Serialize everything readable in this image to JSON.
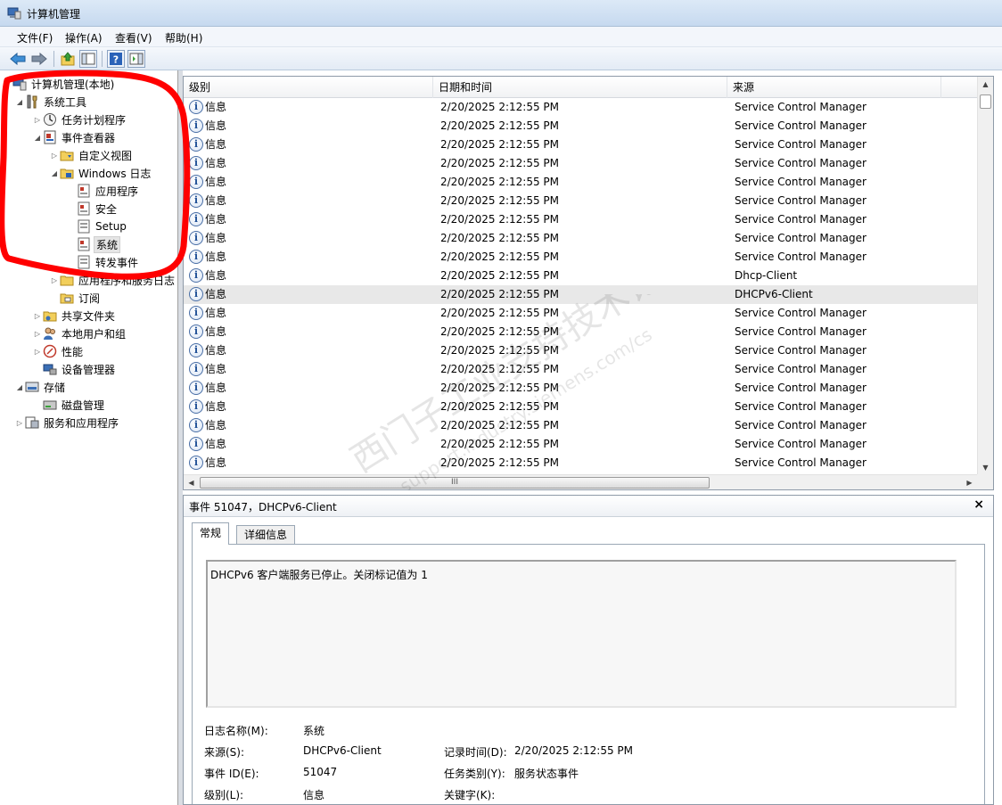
{
  "window": {
    "title": "计算机管理"
  },
  "menu": [
    "文件(F)",
    "操作(A)",
    "查看(V)",
    "帮助(H)"
  ],
  "toolbar": {
    "buttons": [
      "back-icon",
      "forward-icon",
      "up-folder-icon",
      "show-tree-icon",
      "help-icon",
      "action-pane-icon"
    ]
  },
  "tree": [
    {
      "label": "计算机管理(本地)",
      "icon": "computer-management-icon",
      "expander": ""
    },
    {
      "label": "系统工具",
      "icon": "system-tools-icon",
      "expander": "◢"
    },
    {
      "label": "任务计划程序",
      "icon": "task-scheduler-icon",
      "expander": "▷"
    },
    {
      "label": "事件查看器",
      "icon": "event-viewer-icon",
      "expander": "◢"
    },
    {
      "label": "自定义视图",
      "icon": "custom-views-folder-icon",
      "expander": "▷"
    },
    {
      "label": "Windows 日志",
      "icon": "windows-logs-folder-icon",
      "expander": "◢"
    },
    {
      "label": "应用程序",
      "icon": "log-icon",
      "expander": ""
    },
    {
      "label": "安全",
      "icon": "log-icon",
      "expander": ""
    },
    {
      "label": "Setup",
      "icon": "log-icon",
      "expander": ""
    },
    {
      "label": "系统",
      "icon": "log-icon",
      "expander": ""
    },
    {
      "label": "转发事件",
      "icon": "log-icon",
      "expander": ""
    },
    {
      "label": "应用程序和服务日志",
      "icon": "folder-icon",
      "expander": "▷"
    },
    {
      "label": "订阅",
      "icon": "subscriptions-icon",
      "expander": ""
    },
    {
      "label": "共享文件夹",
      "icon": "shared-folders-icon",
      "expander": "▷"
    },
    {
      "label": "本地用户和组",
      "icon": "users-groups-icon",
      "expander": "▷"
    },
    {
      "label": "性能",
      "icon": "performance-icon",
      "expander": "▷"
    },
    {
      "label": "设备管理器",
      "icon": "device-manager-icon",
      "expander": ""
    },
    {
      "label": "存储",
      "icon": "storage-icon",
      "expander": "◢"
    },
    {
      "label": "磁盘管理",
      "icon": "disk-management-icon",
      "expander": ""
    },
    {
      "label": "服务和应用程序",
      "icon": "services-apps-icon",
      "expander": "▷"
    }
  ],
  "events": {
    "columns": [
      "级别",
      "日期和时间",
      "来源"
    ],
    "rows": [
      {
        "level": "信息",
        "datetime": "2/20/2025 2:12:55 PM",
        "source": "Service Control Manager"
      },
      {
        "level": "信息",
        "datetime": "2/20/2025 2:12:55 PM",
        "source": "Service Control Manager"
      },
      {
        "level": "信息",
        "datetime": "2/20/2025 2:12:55 PM",
        "source": "Service Control Manager"
      },
      {
        "level": "信息",
        "datetime": "2/20/2025 2:12:55 PM",
        "source": "Service Control Manager"
      },
      {
        "level": "信息",
        "datetime": "2/20/2025 2:12:55 PM",
        "source": "Service Control Manager"
      },
      {
        "level": "信息",
        "datetime": "2/20/2025 2:12:55 PM",
        "source": "Service Control Manager"
      },
      {
        "level": "信息",
        "datetime": "2/20/2025 2:12:55 PM",
        "source": "Service Control Manager"
      },
      {
        "level": "信息",
        "datetime": "2/20/2025 2:12:55 PM",
        "source": "Service Control Manager"
      },
      {
        "level": "信息",
        "datetime": "2/20/2025 2:12:55 PM",
        "source": "Service Control Manager"
      },
      {
        "level": "信息",
        "datetime": "2/20/2025 2:12:55 PM",
        "source": "Dhcp-Client"
      },
      {
        "level": "信息",
        "datetime": "2/20/2025 2:12:55 PM",
        "source": "DHCPv6-Client"
      },
      {
        "level": "信息",
        "datetime": "2/20/2025 2:12:55 PM",
        "source": "Service Control Manager"
      },
      {
        "level": "信息",
        "datetime": "2/20/2025 2:12:55 PM",
        "source": "Service Control Manager"
      },
      {
        "level": "信息",
        "datetime": "2/20/2025 2:12:55 PM",
        "source": "Service Control Manager"
      },
      {
        "level": "信息",
        "datetime": "2/20/2025 2:12:55 PM",
        "source": "Service Control Manager"
      },
      {
        "level": "信息",
        "datetime": "2/20/2025 2:12:55 PM",
        "source": "Service Control Manager"
      },
      {
        "level": "信息",
        "datetime": "2/20/2025 2:12:55 PM",
        "source": "Service Control Manager"
      },
      {
        "level": "信息",
        "datetime": "2/20/2025 2:12:55 PM",
        "source": "Service Control Manager"
      },
      {
        "level": "信息",
        "datetime": "2/20/2025 2:12:55 PM",
        "source": "Service Control Manager"
      },
      {
        "level": "信息",
        "datetime": "2/20/2025 2:12:55 PM",
        "source": "Service Control Manager"
      }
    ],
    "hscroll_grip": "III"
  },
  "detail": {
    "title": "事件 51047，DHCPv6-Client",
    "close": "×",
    "tabs": [
      "常规",
      "详细信息"
    ],
    "message": "DHCPv6 客户端服务已停止。关闭标记值为 1",
    "log_name_label": "日志名称(M):",
    "log_name_value": "系统",
    "source_label": "来源(S):",
    "source_value": "DHCPv6-Client",
    "logged_label": "记录时间(D):",
    "logged_value": "2/20/2025 2:12:55 PM",
    "event_id_label": "事件 ID(E):",
    "event_id_value": "51047",
    "task_category_label": "任务类别(Y):",
    "task_category_value": "服务状态事件",
    "level_label": "级别(L):",
    "level_value": "信息",
    "keywords_label": "关键字(K):",
    "keywords_value": ""
  },
  "watermark": {
    "line1": "西门子工业支持技术论坛",
    "line2": "support.industry.siemens.com/cs"
  },
  "colors": {
    "annotation": "#ff0000",
    "selection": "#e8e8e8",
    "info_icon": "#1f4f96"
  }
}
